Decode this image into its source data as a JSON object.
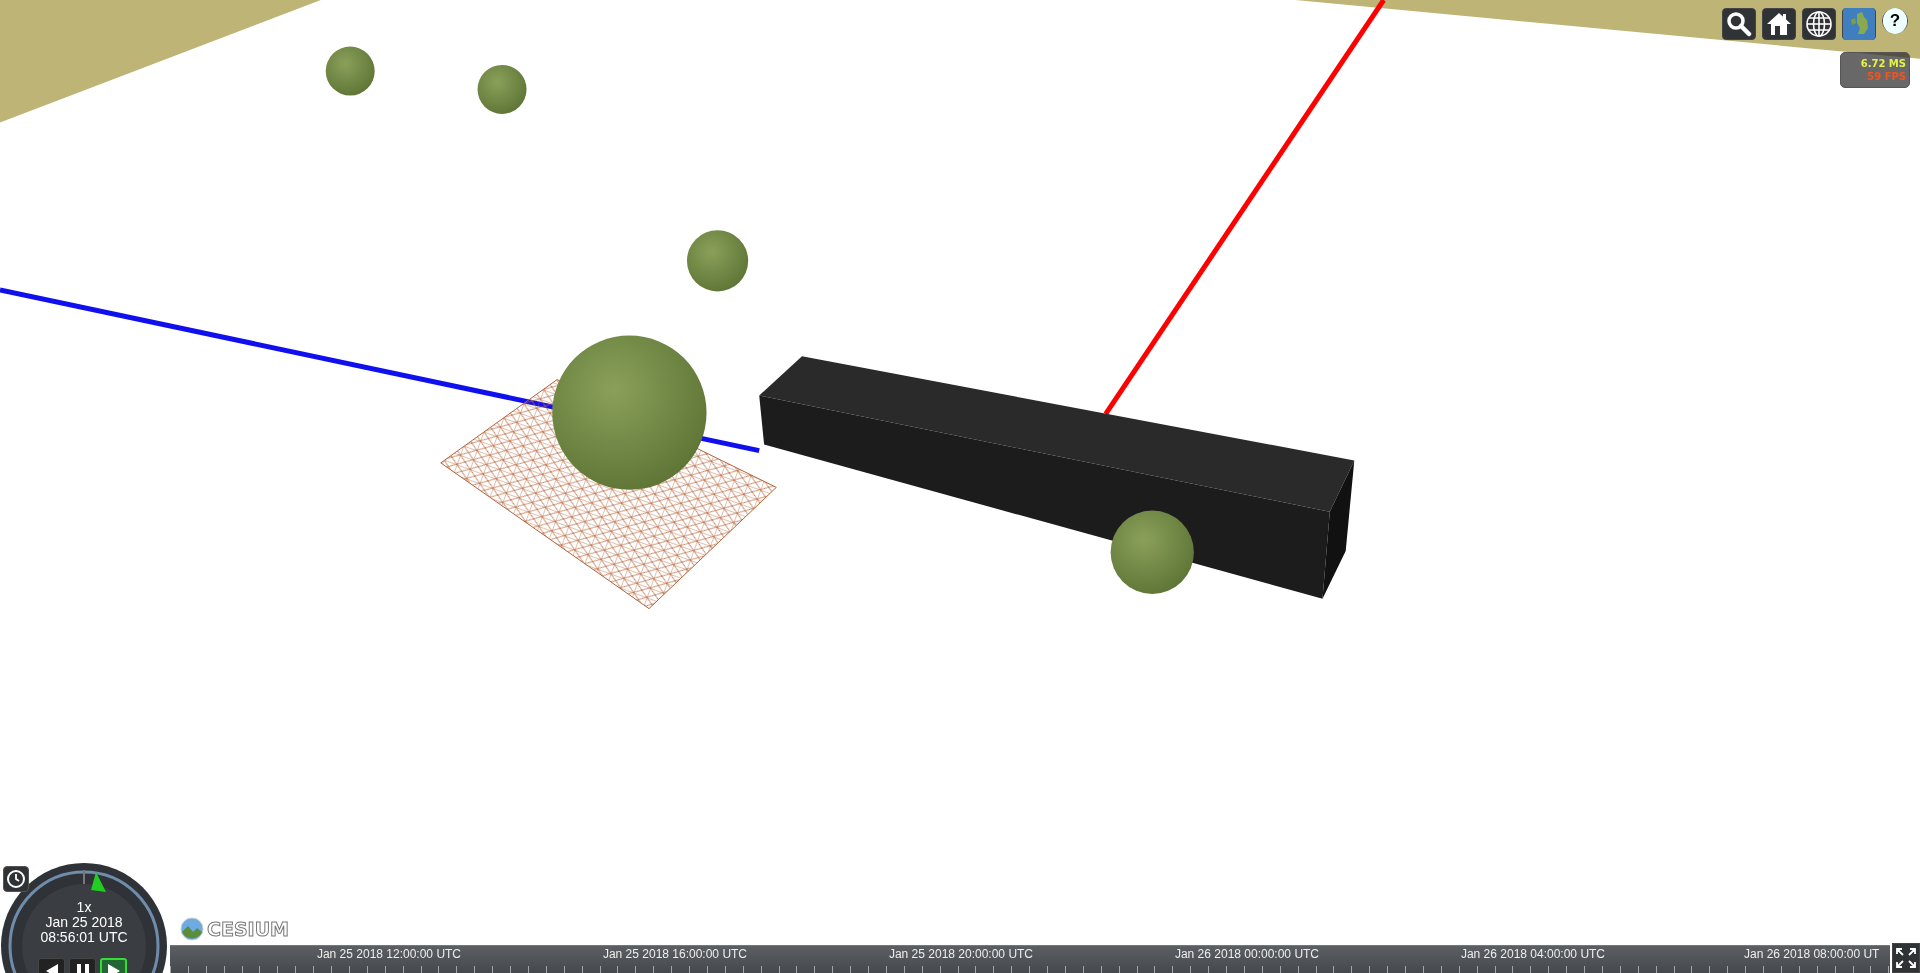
{
  "toolbar": {
    "buttons": [
      {
        "kind": "search"
      },
      {
        "kind": "home"
      },
      {
        "kind": "globe"
      },
      {
        "kind": "imagery"
      },
      {
        "kind": "help",
        "label": "?"
      }
    ]
  },
  "performance": {
    "ms": "6.72 MS",
    "fps": "59 FPS"
  },
  "animation": {
    "speed": "1x",
    "date": "Jan 25 2018",
    "time": "08:56:01 UTC",
    "buttons": [
      {
        "kind": "reverse",
        "selected": false
      },
      {
        "kind": "pause",
        "selected": false
      },
      {
        "kind": "play",
        "selected": true
      }
    ]
  },
  "logo": "CESIUM",
  "timeline": {
    "labels": [
      "Jan 25 2018 12:00:00 UTC",
      "Jan 25 2018 16:00:00 UTC",
      "Jan 25 2018 20:00:00 UTC",
      "Jan 26 2018 00:00:00 UTC",
      "Jan 26 2018 04:00:00 UTC",
      "Jan 26 2018 08:00:00 UT"
    ]
  }
}
